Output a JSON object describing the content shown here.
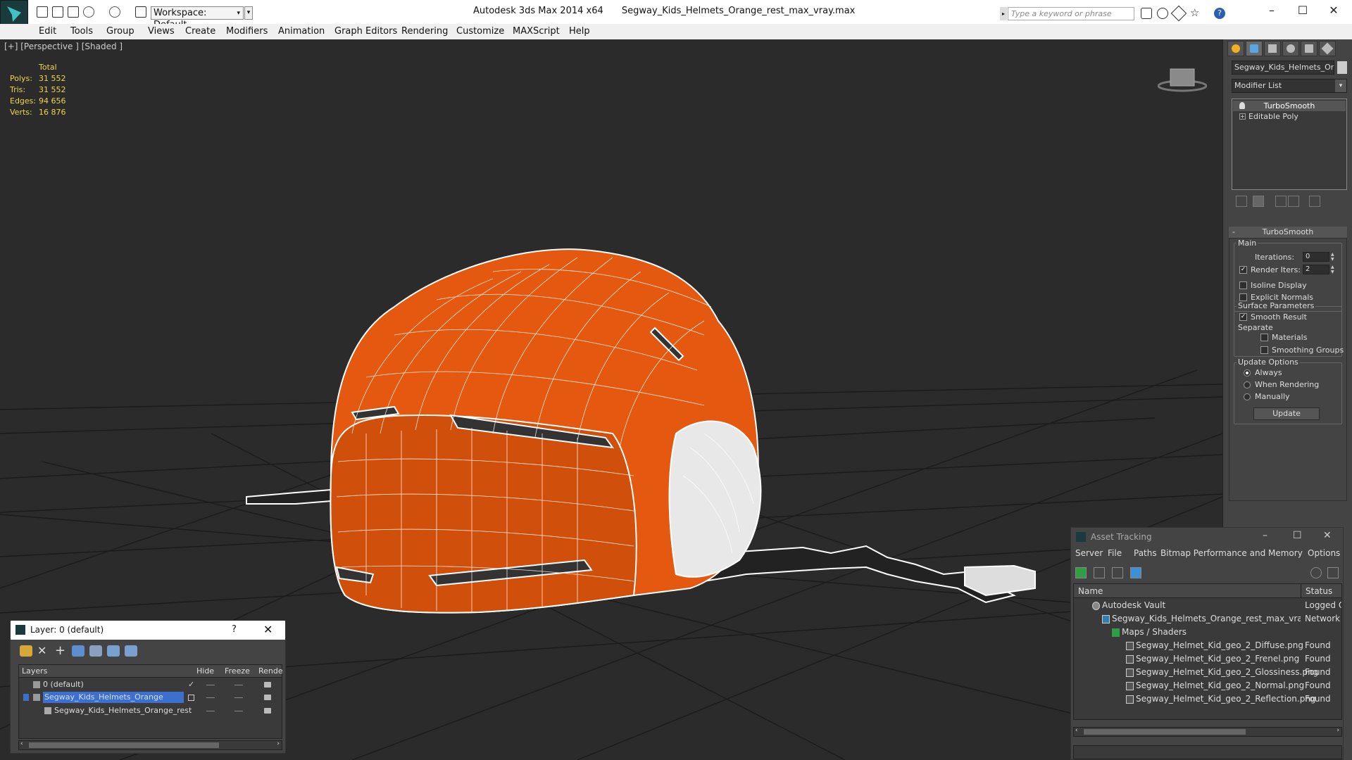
{
  "titlebar": {
    "workspace": "Workspace: Default",
    "app_name": "Autodesk 3ds Max  2014 x64",
    "file_name": "Segway_Kids_Helmets_Orange_rest_max_vray.max",
    "search_placeholder": "Type a keyword or phrase"
  },
  "menu": [
    "Edit",
    "Tools",
    "Group",
    "Views",
    "Create",
    "Modifiers",
    "Animation",
    "Graph Editors",
    "Rendering",
    "Customize",
    "MAXScript",
    "Help"
  ],
  "viewport": {
    "label": "[+] [Perspective ] [Shaded ]",
    "stats": {
      "header": "Total",
      "rows": [
        {
          "k": "Polys:",
          "v": "31 552"
        },
        {
          "k": "Tris:",
          "v": "31 552"
        },
        {
          "k": "Edges:",
          "v": "94 656"
        },
        {
          "k": "Verts:",
          "v": "16 876"
        }
      ]
    },
    "colors": {
      "background": "#2b2b2b",
      "helmet": "#e4590f",
      "grid": "#1a1a1a"
    }
  },
  "command_panel": {
    "object_name": "Segway_Kids_Helmets_Orange",
    "modifier_list": "Modifier List",
    "stack": [
      "TurboSmooth",
      "Editable Poly"
    ],
    "rollout": {
      "title": "TurboSmooth",
      "main": "Main",
      "iterations_label": "Iterations:",
      "iterations_value": "0",
      "render_iters_label": "Render Iters:",
      "render_iters_value": "2",
      "isoline": "Isoline Display",
      "explicit_normals": "Explicit Normals",
      "surface_params": "Surface Parameters",
      "smooth_result": "Smooth Result",
      "separate": "Separate",
      "materials": "Materials",
      "smoothing_groups": "Smoothing Groups",
      "update_options": "Update Options",
      "always": "Always",
      "when_rendering": "When Rendering",
      "manually": "Manually",
      "update_button": "Update"
    }
  },
  "layer_dialog": {
    "title": "Layer: 0 (default)",
    "help": "?",
    "columns": [
      "Layers",
      "Hide",
      "Freeze",
      "Rende"
    ],
    "rows": [
      {
        "name": "0 (default)"
      },
      {
        "name": "Segway_Kids_Helmets_Orange"
      },
      {
        "name": "Segway_Kids_Helmets_Orange_rest"
      }
    ]
  },
  "asset_tracking": {
    "title": "Asset Tracking",
    "menu": [
      "Server",
      "File",
      "Paths",
      "Bitmap Performance and Memory",
      "Options"
    ],
    "columns": [
      "Name",
      "Status"
    ],
    "rows": [
      {
        "name": "Autodesk Vault",
        "status": "Logged O"
      },
      {
        "name": "Segway_Kids_Helmets_Orange_rest_max_vray.max",
        "status": "Network P"
      },
      {
        "name": "Maps / Shaders",
        "status": ""
      },
      {
        "name": "Segway_Helmet_Kid_geo_2_Diffuse.png",
        "status": "Found"
      },
      {
        "name": "Segway_Helmet_Kid_geo_2_Frenel.png",
        "status": "Found"
      },
      {
        "name": "Segway_Helmet_Kid_geo_2_Glossiness.png",
        "status": "Found"
      },
      {
        "name": "Segway_Helmet_Kid_geo_2_Normal.png",
        "status": "Found"
      },
      {
        "name": "Segway_Helmet_Kid_geo_2_Reflection.png",
        "status": "Found"
      }
    ]
  }
}
